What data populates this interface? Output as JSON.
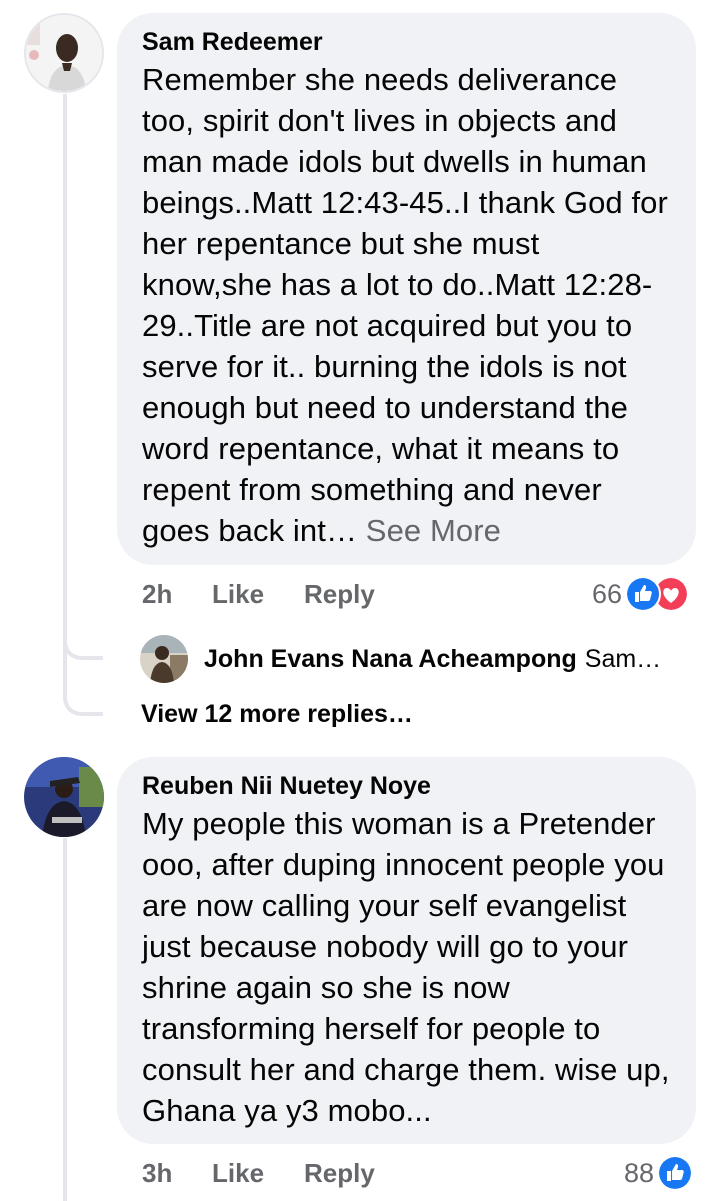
{
  "comments": [
    {
      "author": "Sam Redeemer",
      "text": "Remember she needs deliverance too, spirit don't lives in objects and man made idols but dwells in human beings..Matt 12:43-45..I thank God for her repentance but she must know,she has a lot to do..Matt 12:28-29..Title are not acquired but you to serve for it.. burning the idols is not enough but need to understand the word repentance, what it means to repent from something and never goes back int…",
      "see_more": "See More",
      "time": "2h",
      "like_label": "Like",
      "reply_label": "Reply",
      "reaction_count": "66",
      "reactions": [
        "like-icon",
        "love-icon"
      ]
    },
    {
      "author": "Reuben Nii Nuetey Noye",
      "text": "My people this woman is a Pretender ooo, after duping innocent people you are now calling your self evangelist just because nobody will go to your shrine again so she is now transforming herself for people to consult her and charge them. wise up, Ghana ya y3 mobo...",
      "time": "3h",
      "like_label": "Like",
      "reply_label": "Reply",
      "reaction_count": "88",
      "reactions": [
        "like-icon"
      ]
    }
  ],
  "reply_preview": {
    "author": "John Evans Nana Acheampong",
    "snippet": "Sam…"
  },
  "view_more_replies": "View 12 more replies…",
  "colors": {
    "bubble": "#f0f2f5",
    "muted": "#65676b",
    "like_blue": "#1877f2",
    "love_red": "#f33e58",
    "thread_line": "#e4e6eb"
  }
}
